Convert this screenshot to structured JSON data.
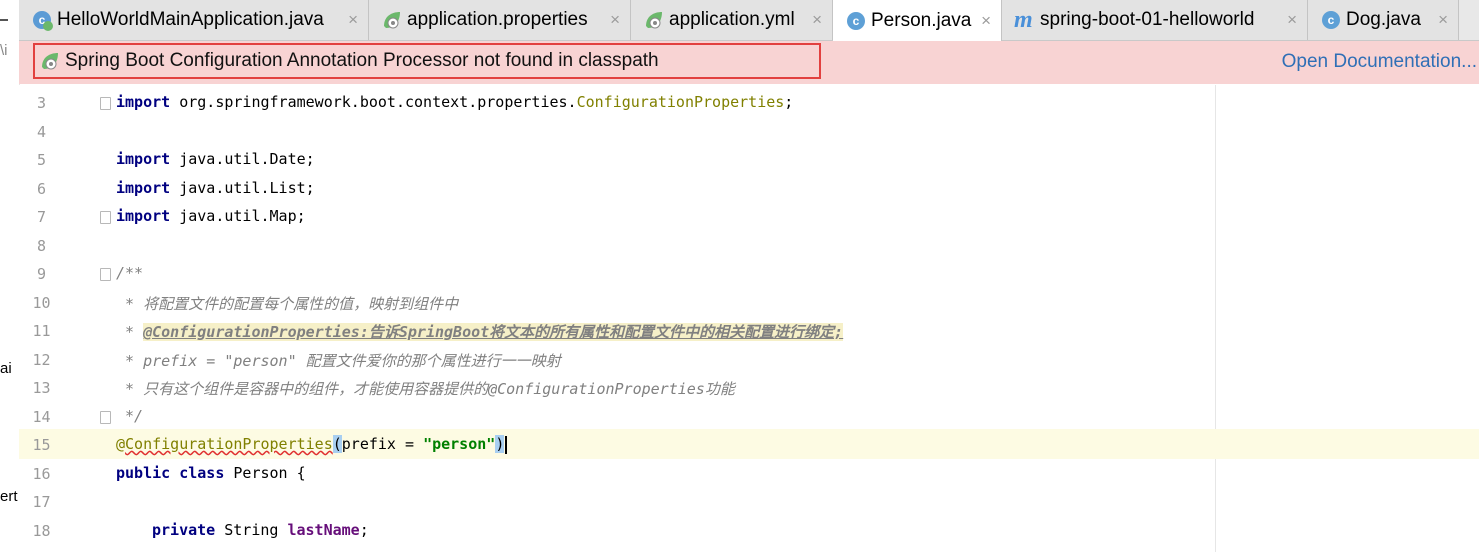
{
  "left_panel": {
    "frag1": "\\i",
    "frag2": "ai",
    "frag3": "ert"
  },
  "tabs": [
    {
      "label": "HelloWorldMainApplication.java",
      "icon": "spring-class-icon",
      "close": "×"
    },
    {
      "label": "application.properties",
      "icon": "spring-properties-icon",
      "close": "×"
    },
    {
      "label": "application.yml",
      "icon": "spring-yml-icon",
      "close": "×"
    },
    {
      "label": "Person.java",
      "icon": "class-icon",
      "close": "×",
      "active": true
    },
    {
      "label": "spring-boot-01-helloworld",
      "icon": "maven-module-icon",
      "close": "×"
    },
    {
      "label": "Dog.java",
      "icon": "class-icon",
      "close": "×"
    }
  ],
  "banner": {
    "message": "Spring Boot Configuration Annotation Processor not found in classpath",
    "link": "Open Documentation..."
  },
  "editor": {
    "line_numbers": [
      "3",
      "4",
      "5",
      "6",
      "7",
      "8",
      "9",
      "10",
      "11",
      "12",
      "13",
      "14",
      "15",
      "16",
      "17",
      "18"
    ],
    "line3": {
      "kw": "import",
      "pkg": " org.springframework.boot.context.properties.",
      "cls": "ConfigurationProperties",
      "end": ";"
    },
    "line5": {
      "kw": "import",
      "rest": " java.util.Date;"
    },
    "line6": {
      "kw": "import",
      "rest": " java.util.List;"
    },
    "line7": {
      "kw": "import",
      "rest": " java.util.Map;"
    },
    "line9": "/**",
    "line10": " * 将配置文件的配置每个属性的值，映射到组件中",
    "line11_prefix": " * ",
    "line11_hl": "@ConfigurationProperties:告诉SpringBoot将文本的所有属性和配置文件中的相关配置进行绑定;",
    "line12": " * prefix = \"person\" 配置文件爱你的那个属性进行一一映射",
    "line13": " * 只有这个组件是容器中的组件，才能使用容器提供的@ConfigurationProperties功能",
    "line14": " */",
    "line15": {
      "at": "@",
      "ann": "ConfigurationProperties",
      "open": "(",
      "param": "prefix = ",
      "str": "\"person\"",
      "close": ")"
    },
    "line16": {
      "kw": "public class",
      "rest": " Person {"
    },
    "line18": {
      "kw": "private",
      "type": " String ",
      "field": "lastName",
      "end": ";"
    }
  },
  "colors": {
    "banner_bg": "#f8d3d3",
    "banner_border": "#e2403f",
    "link": "#2f6fb6",
    "keyword": "#000080",
    "annotation": "#808000",
    "string": "#008000",
    "field": "#660e7a",
    "comment": "#808080"
  }
}
